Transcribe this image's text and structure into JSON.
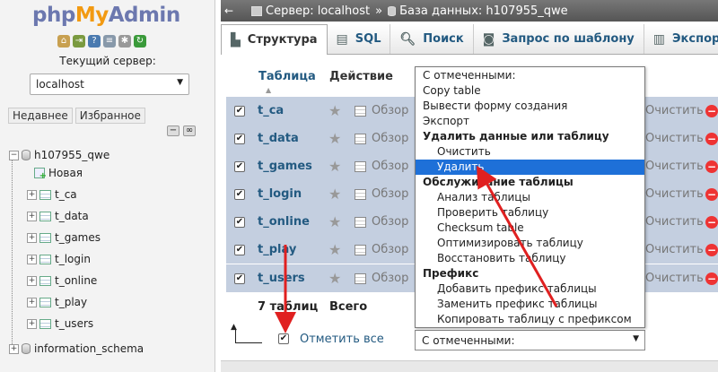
{
  "logo": {
    "part1": "php",
    "part2": "My",
    "part3": "Admin"
  },
  "nav": {
    "quick_icons": [
      "home-icon",
      "exit-icon",
      "help-icon",
      "docs-icon",
      "settings-icon",
      "reload-icon"
    ],
    "server_label": "Текущий сервер:",
    "server_value": "localhost",
    "recent_tab": "Недавнее",
    "favorites_tab": "Избранное",
    "tree": {
      "db1": "h107955_qwe",
      "new_label": "Новая",
      "tables": [
        "t_ca",
        "t_data",
        "t_games",
        "t_login",
        "t_online",
        "t_play",
        "t_users"
      ],
      "db2": "information_schema"
    }
  },
  "breadcrumb": {
    "server": "Сервер: localhost",
    "database": "База данных: h107955_qwe"
  },
  "tabs": [
    {
      "label": "Структура",
      "icon": "structure-icon"
    },
    {
      "label": "SQL",
      "icon": "sql-icon"
    },
    {
      "label": "Поиск",
      "icon": "search-icon"
    },
    {
      "label": "Запрос по шаблону",
      "icon": "query-icon"
    },
    {
      "label": "Экспорт",
      "icon": "export-icon"
    }
  ],
  "table": {
    "col_table": "Таблица",
    "col_action": "Действие",
    "browse_label": "Обзор",
    "clear_label": "Очистить",
    "rows": [
      "t_ca",
      "t_data",
      "t_games",
      "t_login",
      "t_online",
      "t_play",
      "t_users"
    ],
    "summary_count": "7 таблиц",
    "summary_total": "Всего"
  },
  "bottom": {
    "check_all": "Отметить все",
    "with_selected": "С отмеченными:"
  },
  "dropdown": {
    "options": [
      {
        "label": "С отмеченными:",
        "kind": "item"
      },
      {
        "label": "Copy table",
        "kind": "item"
      },
      {
        "label": "Вывести форму создания",
        "kind": "item"
      },
      {
        "label": "Экспорт",
        "kind": "item"
      },
      {
        "label": "Удалить данные или таблицу",
        "kind": "group"
      },
      {
        "label": "Очистить",
        "kind": "sub"
      },
      {
        "label": "Удалить",
        "kind": "sub",
        "highlighted": true
      },
      {
        "label": "Обслуживание таблицы",
        "kind": "group"
      },
      {
        "label": "Анализ таблицы",
        "kind": "sub"
      },
      {
        "label": "Проверить таблицу",
        "kind": "sub"
      },
      {
        "label": "Checksum table",
        "kind": "sub"
      },
      {
        "label": "Оптимизировать таблицу",
        "kind": "sub"
      },
      {
        "label": "Восстановить таблицу",
        "kind": "sub"
      },
      {
        "label": "Префикс",
        "kind": "group"
      },
      {
        "label": "Добавить префикс таблицы",
        "kind": "sub"
      },
      {
        "label": "Заменить префикс таблицы",
        "kind": "sub"
      },
      {
        "label": "Копировать таблицу с префиксом",
        "kind": "sub"
      }
    ]
  },
  "colors": {
    "accent": "#235a81",
    "highlight": "#1e70d8",
    "annotation": "#e02020"
  }
}
